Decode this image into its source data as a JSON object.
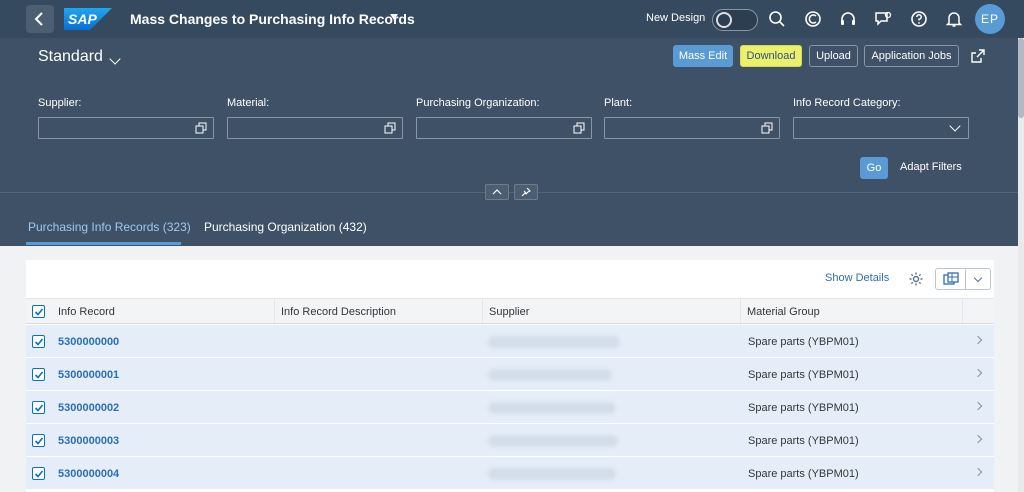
{
  "shell": {
    "brand": "SAP",
    "app_title": "Mass Changes to Purchasing Info Records",
    "new_design_label": "New Design",
    "avatar_initials": "EP",
    "icons": [
      "search-icon",
      "copilot-icon",
      "help-headset-icon",
      "feedback-icon",
      "help-icon",
      "notifications-bell-icon"
    ]
  },
  "header": {
    "variant": "Standard",
    "toolbar": {
      "mass_edit": "Mass Edit",
      "download": "Download",
      "upload": "Upload",
      "application_jobs": "Application Jobs"
    },
    "filters": [
      {
        "label": "Supplier:",
        "value": ""
      },
      {
        "label": "Material:",
        "value": ""
      },
      {
        "label": "Purchasing Organization:",
        "value": ""
      },
      {
        "label": "Plant:",
        "value": ""
      },
      {
        "label": "Info Record Category:",
        "value": ""
      }
    ],
    "go": "Go",
    "adapt_filters": "Adapt Filters"
  },
  "tabs": [
    {
      "label": "Purchasing Info Records (323)",
      "active": true
    },
    {
      "label": "Purchasing Organization (432)",
      "active": false
    }
  ],
  "table": {
    "show_details": "Show Details",
    "columns": [
      "Info Record",
      "Info Record Description",
      "Supplier",
      "Material Group"
    ],
    "rows": [
      {
        "info_record": "5300000000",
        "description": "",
        "supplier": "",
        "material_group": "Spare parts (YBPM01)",
        "selected": true
      },
      {
        "info_record": "5300000001",
        "description": "",
        "supplier": "",
        "material_group": "Spare parts (YBPM01)",
        "selected": true
      },
      {
        "info_record": "5300000002",
        "description": "",
        "supplier": "",
        "material_group": "Spare parts (YBPM01)",
        "selected": true
      },
      {
        "info_record": "5300000003",
        "description": "",
        "supplier": "",
        "material_group": "Spare parts (YBPM01)",
        "selected": true
      },
      {
        "info_record": "5300000004",
        "description": "",
        "supplier": "",
        "material_group": "Spare parts (YBPM01)",
        "selected": true
      }
    ]
  },
  "colors": {
    "shell_bg": "#354a5f",
    "header_bg": "#3e5166",
    "accent": "#5b9bd5",
    "download_highlight": "#ecf06b",
    "link": "#2c6eb3",
    "row_selected": "#e5eef8"
  }
}
